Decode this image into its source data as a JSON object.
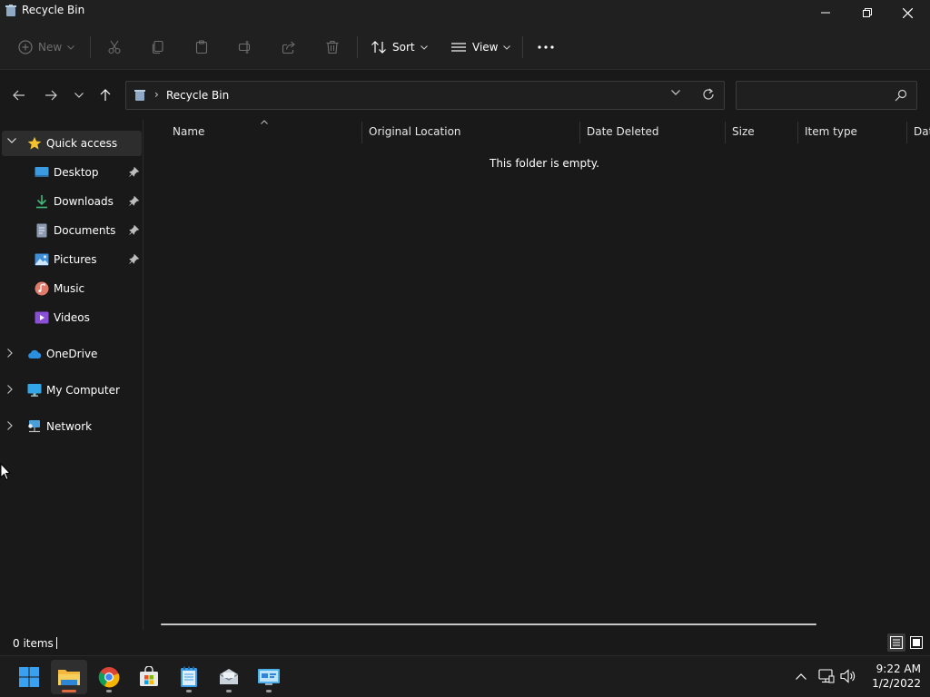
{
  "window": {
    "title": "Recycle Bin",
    "icon": "recycle-bin-icon"
  },
  "commandbar": {
    "new_label": "New",
    "sort_label": "Sort",
    "view_label": "View",
    "icons": [
      "cut-icon",
      "copy-icon",
      "paste-icon",
      "rename-icon",
      "share-icon",
      "delete-icon",
      "more-icon"
    ]
  },
  "address": {
    "crumb": "Recycle Bin",
    "search_placeholder": ""
  },
  "sidebar": {
    "quick_access": "Quick access",
    "items": [
      {
        "label": "Desktop",
        "icon": "desktop-icon",
        "pinned": true
      },
      {
        "label": "Downloads",
        "icon": "downloads-icon",
        "pinned": true
      },
      {
        "label": "Documents",
        "icon": "documents-icon",
        "pinned": true
      },
      {
        "label": "Pictures",
        "icon": "pictures-icon",
        "pinned": true
      },
      {
        "label": "Music",
        "icon": "music-icon",
        "pinned": false
      },
      {
        "label": "Videos",
        "icon": "videos-icon",
        "pinned": false
      }
    ],
    "roots": [
      {
        "label": "OneDrive",
        "icon": "onedrive-icon"
      },
      {
        "label": "My Computer",
        "icon": "computer-icon"
      },
      {
        "label": "Network",
        "icon": "network-icon"
      }
    ]
  },
  "content": {
    "columns": [
      "Name",
      "Original Location",
      "Date Deleted",
      "Size",
      "Item type",
      "Dat"
    ],
    "empty_message": "This folder is empty."
  },
  "status": {
    "count": "0 items"
  },
  "taskbar": {
    "apps": [
      "start-icon",
      "file-explorer-icon",
      "chrome-icon",
      "store-icon",
      "notepad-icon",
      "mail-icon",
      "control-panel-icon"
    ],
    "time": "9:22 AM",
    "date": "1/2/2022"
  },
  "colors": {
    "background": "#191919",
    "chrome": "#202020",
    "text": "#ffffff",
    "disabled": "#6e6e6e",
    "accent": "#e06a3b"
  }
}
